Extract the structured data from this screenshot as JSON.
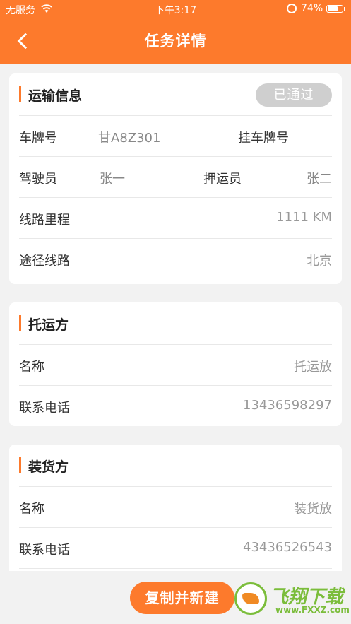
{
  "status_bar": {
    "carrier": "无服务",
    "time": "下午3:17",
    "battery": "74%",
    "battery_level": 0.74
  },
  "nav": {
    "title": "任务详情"
  },
  "transport": {
    "title": "运输信息",
    "badge": "已通过",
    "plate_label": "车牌号",
    "plate_value": "甘A8Z301",
    "trailer_label": "挂车牌号",
    "driver_label": "驾驶员",
    "driver_value": "张一",
    "escort_label": "押运员",
    "escort_value": "张二",
    "mileage_label": "线路里程",
    "mileage_value": "1111 KM",
    "route_label": "途径线路",
    "route_value": "北京"
  },
  "shipper": {
    "title": "托运方",
    "name_label": "名称",
    "name_value": "托运放",
    "phone_label": "联系电话",
    "phone_value": "13436598297"
  },
  "loader": {
    "title": "装货方",
    "name_label": "名称",
    "name_value": "装货放",
    "phone_label": "联系电话",
    "phone_value": "43436526543"
  },
  "actions": {
    "copy_label": "复制并新建"
  },
  "watermark": {
    "title": "飞翔下载",
    "url": "www.FXXZ.com"
  }
}
